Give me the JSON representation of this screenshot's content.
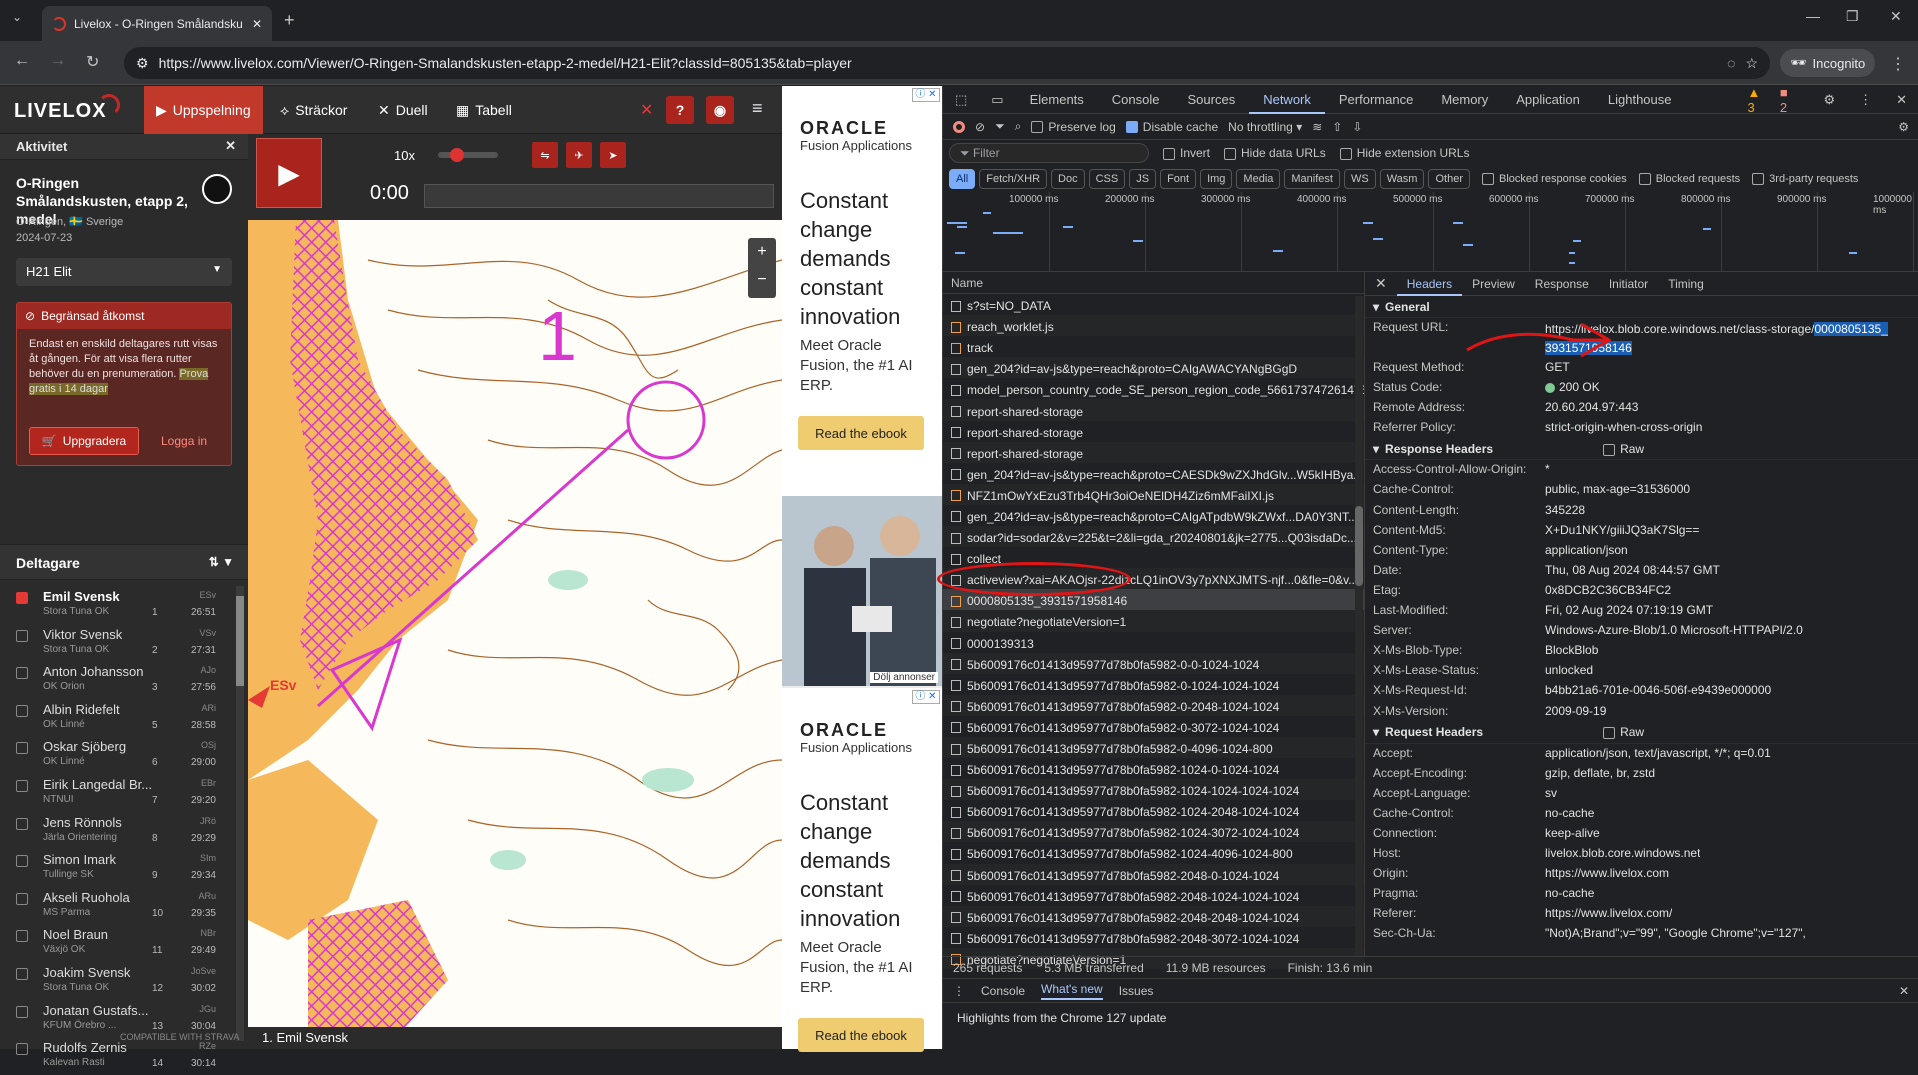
{
  "browser": {
    "tab_title": "Livelox - O-Ringen Smålandsku",
    "url": "https://www.livelox.com/Viewer/O-Ringen-Smalandskusten-etapp-2-medel/H21-Elit?classId=805135&tab=player",
    "incognito_label": "Incognito"
  },
  "app": {
    "logo": "LIVELOX",
    "nav": {
      "playback": "Uppspelning",
      "legs": "Sträckor",
      "duel": "Duell",
      "table": "Tabell"
    },
    "help": "?",
    "activity": {
      "header": "Aktivitet",
      "title": "O-Ringen Smålandskusten, etapp 2, medel",
      "org": "O-Ringen, 🇸🇪 Sverige",
      "date": "2024-07-23",
      "class": "H21 Elit"
    },
    "restricted": {
      "title": "Begränsad åtkomst",
      "body": "Endast en enskild deltagares rutt visas åt gången. För att visa flera rutter behöver du en prenumeration.",
      "trial": "Prova gratis i 14 dagar",
      "upgrade": "Uppgradera",
      "login": "Logga in"
    },
    "participants_header": "Deltagare",
    "participants": [
      {
        "name": "Emil Svensk",
        "club": "Stora Tuna OK",
        "abbr": "ESv",
        "place": "1",
        "time": "26:51",
        "checked": true
      },
      {
        "name": "Viktor Svensk",
        "club": "Stora Tuna OK",
        "abbr": "VSv",
        "place": "2",
        "time": "27:31",
        "checked": false
      },
      {
        "name": "Anton Johansson",
        "club": "OK Orion",
        "abbr": "AJo",
        "place": "3",
        "time": "27:56",
        "checked": false
      },
      {
        "name": "Albin Ridefelt",
        "club": "OK Linné",
        "abbr": "ARi",
        "place": "5",
        "time": "28:58",
        "checked": false
      },
      {
        "name": "Oskar Sjöberg",
        "club": "OK Linné",
        "abbr": "OSj",
        "place": "6",
        "time": "29:00",
        "checked": false
      },
      {
        "name": "Eirik Langedal Br...",
        "club": "NTNUI",
        "abbr": "EBr",
        "place": "7",
        "time": "29:20",
        "checked": false
      },
      {
        "name": "Jens Rönnols",
        "club": "Järla Orientering",
        "abbr": "JRö",
        "place": "8",
        "time": "29:29",
        "checked": false
      },
      {
        "name": "Simon Imark",
        "club": "Tullinge SK",
        "abbr": "SIm",
        "place": "9",
        "time": "29:34",
        "checked": false
      },
      {
        "name": "Akseli Ruohola",
        "club": "MS Parma",
        "abbr": "ARu",
        "place": "10",
        "time": "29:35",
        "checked": false
      },
      {
        "name": "Noel Braun",
        "club": "Växjö OK",
        "abbr": "NBr",
        "place": "11",
        "time": "29:49",
        "checked": false
      },
      {
        "name": "Joakim Svensk",
        "club": "Stora Tuna OK",
        "abbr": "JoSve",
        "place": "12",
        "time": "30:02",
        "checked": false
      },
      {
        "name": "Jonatan Gustafs...",
        "club": "KFUM Örebro ...",
        "abbr": "JGu",
        "place": "13",
        "time": "30:04",
        "checked": false
      },
      {
        "name": "Rudolfs Zernis",
        "club": "Kalevan Rasti",
        "abbr": "RZe",
        "place": "14",
        "time": "30:14",
        "checked": false
      }
    ],
    "strava": "COMPATIBLE WITH STRAVA",
    "player": {
      "speed": "10x",
      "time": "0:00"
    },
    "map_runner_label": "ESv",
    "map_control_number": "1",
    "map_footer": "1. Emil Svensk"
  },
  "ads": {
    "brand": "ORACLE",
    "sub": "Fusion Applications",
    "headline": "Constant change demands constant innovation",
    "copy": "Meet Oracle Fusion, the #1 AI ERP.",
    "cta": "Read the ebook",
    "hide": "Dölj annonser"
  },
  "devtools": {
    "tabs": [
      "Elements",
      "Console",
      "Sources",
      "Network",
      "Performance",
      "Memory",
      "Application",
      "Lighthouse"
    ],
    "active_tab": "Network",
    "warnings": "3",
    "errors": "2",
    "toolbar": {
      "preserve_log": "Preserve log",
      "disable_cache": "Disable cache",
      "throttling": "No throttling"
    },
    "filter": {
      "placeholder": "Filter",
      "invert": "Invert",
      "hide_data": "Hide data URLs",
      "hide_ext": "Hide extension URLs"
    },
    "types": [
      "All",
      "Fetch/XHR",
      "Doc",
      "CSS",
      "JS",
      "Font",
      "Img",
      "Media",
      "Manifest",
      "WS",
      "Wasm",
      "Other"
    ],
    "type_opts": {
      "blocked_cookies": "Blocked response cookies",
      "blocked_req": "Blocked requests",
      "third_party": "3rd-party requests"
    },
    "timeline_ticks": [
      "100000 ms",
      "200000 ms",
      "300000 ms",
      "400000 ms",
      "500000 ms",
      "600000 ms",
      "700000 ms",
      "800000 ms",
      "900000 ms",
      "1000000 ms"
    ],
    "list_header": "Name",
    "requests": [
      {
        "name": "s?st=NO_DATA",
        "type": "doc"
      },
      {
        "name": "reach_worklet.js",
        "type": "js"
      },
      {
        "name": "track",
        "type": "js"
      },
      {
        "name": "gen_204?id=av-js&type=reach&proto=CAIgAWACYANgBGgD",
        "type": "doc"
      },
      {
        "name": "model_person_country_code_SE_person_region_code_566173747261476...",
        "type": "doc"
      },
      {
        "name": "report-shared-storage",
        "type": "doc"
      },
      {
        "name": "report-shared-storage",
        "type": "doc"
      },
      {
        "name": "report-shared-storage",
        "type": "doc"
      },
      {
        "name": "gen_204?id=av-js&type=reach&proto=CAESDk9wZXJhdGlv...W5kIHBya...",
        "type": "doc"
      },
      {
        "name": "NFZ1mOwYxEzu3Trb4QHr3oiOeNElDH4Ziz6mMFaiIXI.js",
        "type": "js"
      },
      {
        "name": "gen_204?id=av-js&type=reach&proto=CAIgATpdbW9kZWxf...DA0Y3NT...",
        "type": "doc"
      },
      {
        "name": "sodar?id=sodar2&v=225&t=2&li=gda_r20240801&jk=2775...Q03isdaDc...",
        "type": "doc"
      },
      {
        "name": "collect",
        "type": "doc"
      },
      {
        "name": "activeview?xai=AKAOjsr-22dizcLQ1inOV3y7pXNXJMTS-njf...0&fle=0&v...",
        "type": "doc"
      },
      {
        "name": "0000805135_3931571958146",
        "type": "js",
        "selected": true
      },
      {
        "name": "negotiate?negotiateVersion=1",
        "type": "doc"
      },
      {
        "name": "0000139313",
        "type": "doc"
      },
      {
        "name": "5b6009176c01413d95977d78b0fa5982-0-0-1024-1024",
        "type": "doc"
      },
      {
        "name": "5b6009176c01413d95977d78b0fa5982-0-1024-1024-1024",
        "type": "doc"
      },
      {
        "name": "5b6009176c01413d95977d78b0fa5982-0-2048-1024-1024",
        "type": "doc"
      },
      {
        "name": "5b6009176c01413d95977d78b0fa5982-0-3072-1024-1024",
        "type": "doc"
      },
      {
        "name": "5b6009176c01413d95977d78b0fa5982-0-4096-1024-800",
        "type": "doc"
      },
      {
        "name": "5b6009176c01413d95977d78b0fa5982-1024-0-1024-1024",
        "type": "doc"
      },
      {
        "name": "5b6009176c01413d95977d78b0fa5982-1024-1024-1024-1024",
        "type": "doc"
      },
      {
        "name": "5b6009176c01413d95977d78b0fa5982-1024-2048-1024-1024",
        "type": "doc"
      },
      {
        "name": "5b6009176c01413d95977d78b0fa5982-1024-3072-1024-1024",
        "type": "doc"
      },
      {
        "name": "5b6009176c01413d95977d78b0fa5982-1024-4096-1024-800",
        "type": "doc"
      },
      {
        "name": "5b6009176c01413d95977d78b0fa5982-2048-0-1024-1024",
        "type": "doc"
      },
      {
        "name": "5b6009176c01413d95977d78b0fa5982-2048-1024-1024-1024",
        "type": "doc"
      },
      {
        "name": "5b6009176c01413d95977d78b0fa5982-2048-2048-1024-1024",
        "type": "doc"
      },
      {
        "name": "5b6009176c01413d95977d78b0fa5982-2048-3072-1024-1024",
        "type": "doc"
      },
      {
        "name": "negotiate?negotiateVersion=1",
        "type": "js"
      }
    ],
    "detail_tabs": [
      "Headers",
      "Preview",
      "Response",
      "Initiator",
      "Timing"
    ],
    "general_title": "General",
    "general": [
      {
        "k": "Request URL:",
        "v1": "https://livelox.blob.core.windows.net/class-storage/",
        "v2": "0000805135_",
        "v3": "3931571958146"
      },
      {
        "k": "Request Method:",
        "v": "GET"
      },
      {
        "k": "Status Code:",
        "v": "200 OK"
      },
      {
        "k": "Remote Address:",
        "v": "20.60.204.97:443"
      },
      {
        "k": "Referrer Policy:",
        "v": "strict-origin-when-cross-origin"
      }
    ],
    "response_title": "Response Headers",
    "raw_label": "Raw",
    "response_headers": [
      {
        "k": "Access-Control-Allow-Origin:",
        "v": "*"
      },
      {
        "k": "Cache-Control:",
        "v": "public, max-age=31536000"
      },
      {
        "k": "Content-Length:",
        "v": "345228"
      },
      {
        "k": "Content-Md5:",
        "v": "X+Du1NKY/giiiJQ3aK7Slg=="
      },
      {
        "k": "Content-Type:",
        "v": "application/json"
      },
      {
        "k": "Date:",
        "v": "Thu, 08 Aug 2024 08:44:57 GMT"
      },
      {
        "k": "Etag:",
        "v": "0x8DCB2C36CB34FC2"
      },
      {
        "k": "Last-Modified:",
        "v": "Fri, 02 Aug 2024 07:19:19 GMT"
      },
      {
        "k": "Server:",
        "v": "Windows-Azure-Blob/1.0 Microsoft-HTTPAPI/2.0"
      },
      {
        "k": "X-Ms-Blob-Type:",
        "v": "BlockBlob"
      },
      {
        "k": "X-Ms-Lease-Status:",
        "v": "unlocked"
      },
      {
        "k": "X-Ms-Request-Id:",
        "v": "b4bb21a6-701e-0046-506f-e9439e000000"
      },
      {
        "k": "X-Ms-Version:",
        "v": "2009-09-19"
      }
    ],
    "request_title": "Request Headers",
    "request_headers": [
      {
        "k": "Accept:",
        "v": "application/json, text/javascript, */*; q=0.01"
      },
      {
        "k": "Accept-Encoding:",
        "v": "gzip, deflate, br, zstd"
      },
      {
        "k": "Accept-Language:",
        "v": "sv"
      },
      {
        "k": "Cache-Control:",
        "v": "no-cache"
      },
      {
        "k": "Connection:",
        "v": "keep-alive"
      },
      {
        "k": "Host:",
        "v": "livelox.blob.core.windows.net"
      },
      {
        "k": "Origin:",
        "v": "https://www.livelox.com"
      },
      {
        "k": "Pragma:",
        "v": "no-cache"
      },
      {
        "k": "Referer:",
        "v": "https://www.livelox.com/"
      },
      {
        "k": "Sec-Ch-Ua:",
        "v": "\"Not)A;Brand\";v=\"99\", \"Google Chrome\";v=\"127\","
      }
    ],
    "status": {
      "requests": "265 requests",
      "transferred": "5.3 MB transferred",
      "resources": "11.9 MB resources",
      "finish": "Finish: 13.6 min"
    },
    "drawer_tabs": [
      "Console",
      "What's new",
      "Issues"
    ],
    "whats_new": "Highlights from the Chrome 127 update"
  }
}
